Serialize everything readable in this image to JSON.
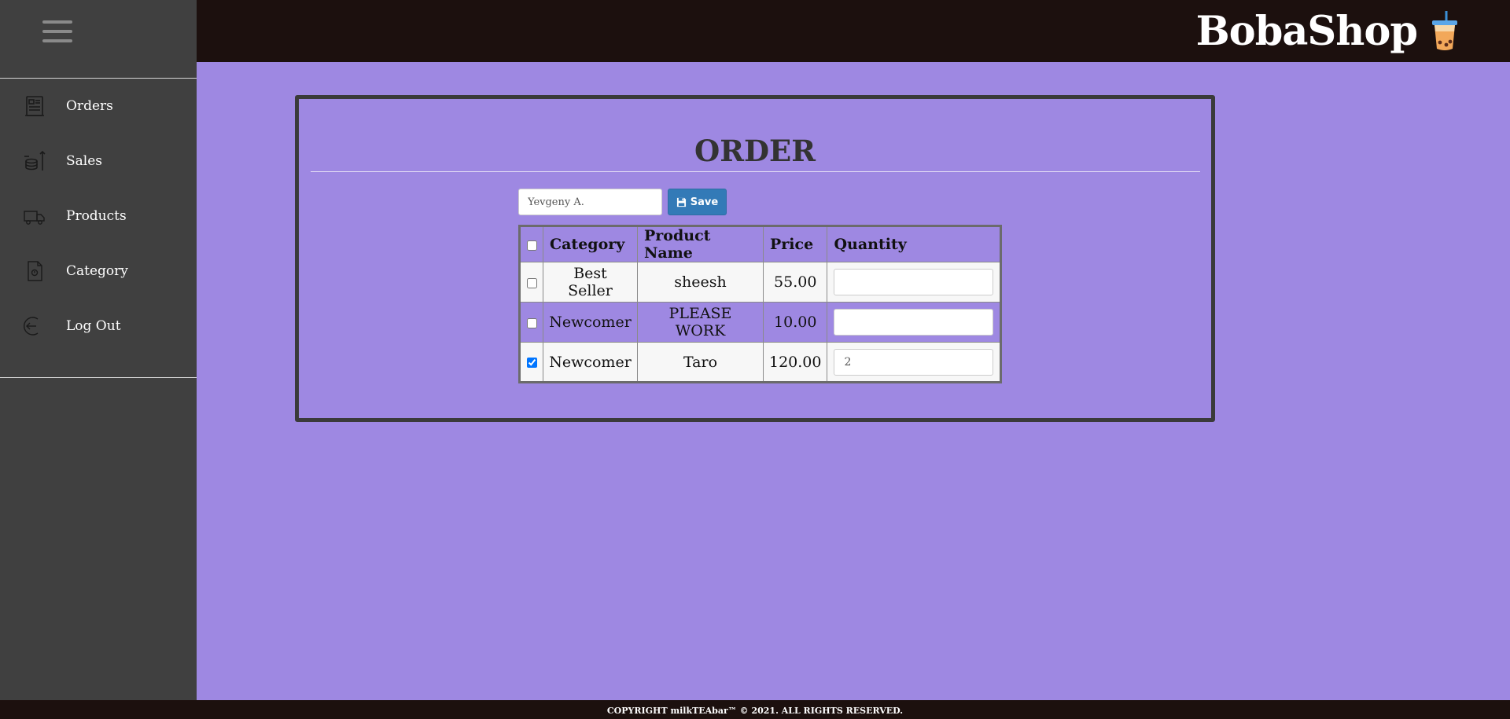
{
  "brand": {
    "name": "BobaShop",
    "icon": "boba-cup-icon"
  },
  "sidebar": {
    "menu_icon": "hamburger-icon",
    "items": [
      {
        "label": "Orders",
        "icon": "receipt-icon"
      },
      {
        "label": "Sales",
        "icon": "coins-chart-icon"
      },
      {
        "label": "Products",
        "icon": "truck-icon"
      },
      {
        "label": "Category",
        "icon": "document-icon"
      },
      {
        "label": "Log Out",
        "icon": "logout-icon"
      }
    ]
  },
  "order": {
    "title": "ORDER",
    "customer_placeholder": "Yevgeny A.",
    "save_label": "Save",
    "table": {
      "headers": [
        "Category",
        "Product Name",
        "Price",
        "Quantity"
      ],
      "rows": [
        {
          "checked": false,
          "category": "Best Seller",
          "product": "sheesh",
          "price": "55.00",
          "quantity": ""
        },
        {
          "checked": false,
          "category": "Newcomer",
          "product": "PLEASE WORK",
          "price": "10.00",
          "quantity": ""
        },
        {
          "checked": true,
          "category": "Newcomer",
          "product": "Taro",
          "price": "120.00",
          "quantity": "2"
        }
      ]
    }
  },
  "footer": {
    "text": "COPYRIGHT milkTEAbar™ © 2021. ALL RIGHTS RESERVED."
  },
  "colors": {
    "background": "#9e88e2",
    "sidebar": "#404040",
    "header": "#1c100e",
    "save_button": "#337ab7"
  }
}
